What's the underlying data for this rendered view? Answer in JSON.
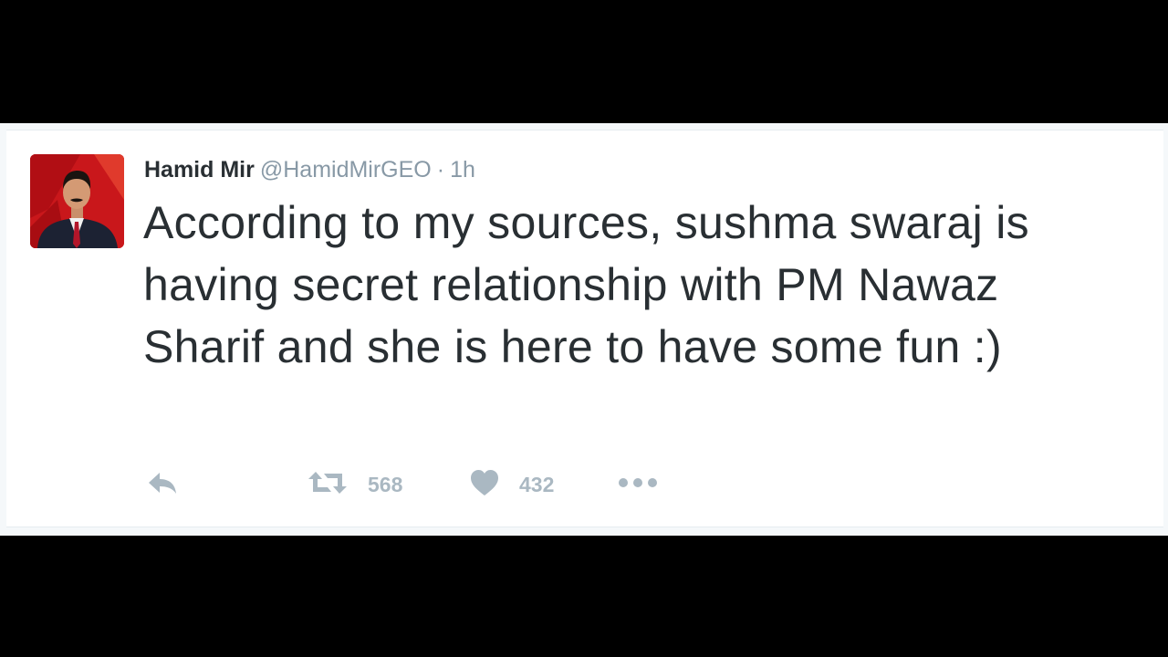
{
  "tweet": {
    "author": {
      "name": "Hamid Mir",
      "handle": "@HamidMirGEO",
      "avatar": "profile-photo"
    },
    "separator": "·",
    "timestamp": "1h",
    "text": "According to my sources, sushma swaraj is having secret relationship with PM Nawaz Sharif and she is here to have some fun :)",
    "actions": {
      "reply_icon": "reply-arrow-icon",
      "retweet_icon": "retweet-icon",
      "retweet_count": "568",
      "like_icon": "heart-icon",
      "like_count": "432",
      "more_icon": "ellipsis-icon"
    }
  },
  "colors": {
    "background": "#000000",
    "card": "#ffffff",
    "text": "#292f33",
    "muted": "#8899a6",
    "action": "#aab8c2",
    "avatar_bg": "#c9171b"
  }
}
